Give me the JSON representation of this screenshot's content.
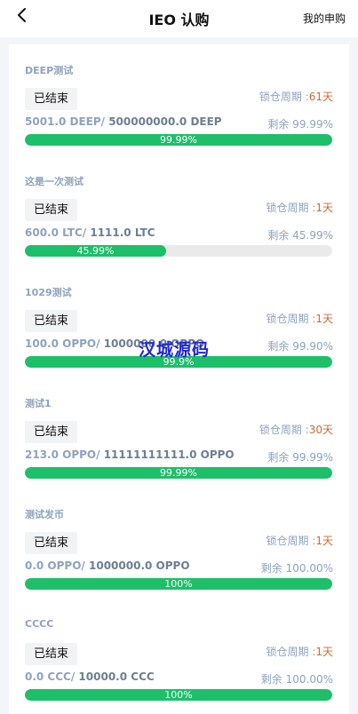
{
  "header": {
    "title": "IEO 认购",
    "my_link": "我的申购"
  },
  "watermark": "汉城源码",
  "items": [
    {
      "name": "DEEP测试",
      "status": "已结束",
      "lock_label": "锁仓周期 :",
      "lock_value": "61天",
      "sold": "5001.0 DEEP/",
      "total": " 500000000.0 DEEP",
      "remain_label": "剩余",
      "remain_value": "99.99%",
      "progress": 1.0,
      "progress_text": "99.99%"
    },
    {
      "name": "这是一次测试",
      "status": "已结束",
      "lock_label": "锁仓周期 :",
      "lock_value": "1天",
      "sold": "600.0 LTC/",
      "total": " 1111.0 LTC",
      "remain_label": "剩余",
      "remain_value": "45.99%",
      "progress": 0.4599,
      "progress_text": "45.99%"
    },
    {
      "name": "1029测试",
      "status": "已结束",
      "lock_label": "锁仓周期 :",
      "lock_value": "1天",
      "sold": "100.0 OPPO/",
      "total": " 1000000.0 OPPO",
      "remain_label": "剩余",
      "remain_value": "99.90%",
      "progress": 1.0,
      "progress_text": "99.9%"
    },
    {
      "name": "测试1",
      "status": "已结束",
      "lock_label": "锁仓周期 :",
      "lock_value": "30天",
      "sold": "213.0 OPPO/",
      "total": " 11111111111.0 OPPO",
      "remain_label": "剩余",
      "remain_value": "99.99%",
      "progress": 1.0,
      "progress_text": "99.99%"
    },
    {
      "name": "测试发币",
      "status": "已结束",
      "lock_label": "锁仓周期 :",
      "lock_value": "1天",
      "sold": "0.0 OPPO/",
      "total": " 1000000.0 OPPO",
      "remain_label": "剩余",
      "remain_value": "100.00%",
      "progress": 1.0,
      "progress_text": "100%"
    },
    {
      "name": "CCCC",
      "status": "已结束",
      "lock_label": "锁仓周期 :",
      "lock_value": "1天",
      "sold": "0.0 CCC/",
      "total": " 10000.0 CCC",
      "remain_label": "剩余",
      "remain_value": "100.00%",
      "progress": 1.0,
      "progress_text": "100%"
    }
  ],
  "colors": {
    "accent_green": "#1dbf68",
    "lock_orange": "#d16a33",
    "muted_blue": "#8ea3bd"
  }
}
